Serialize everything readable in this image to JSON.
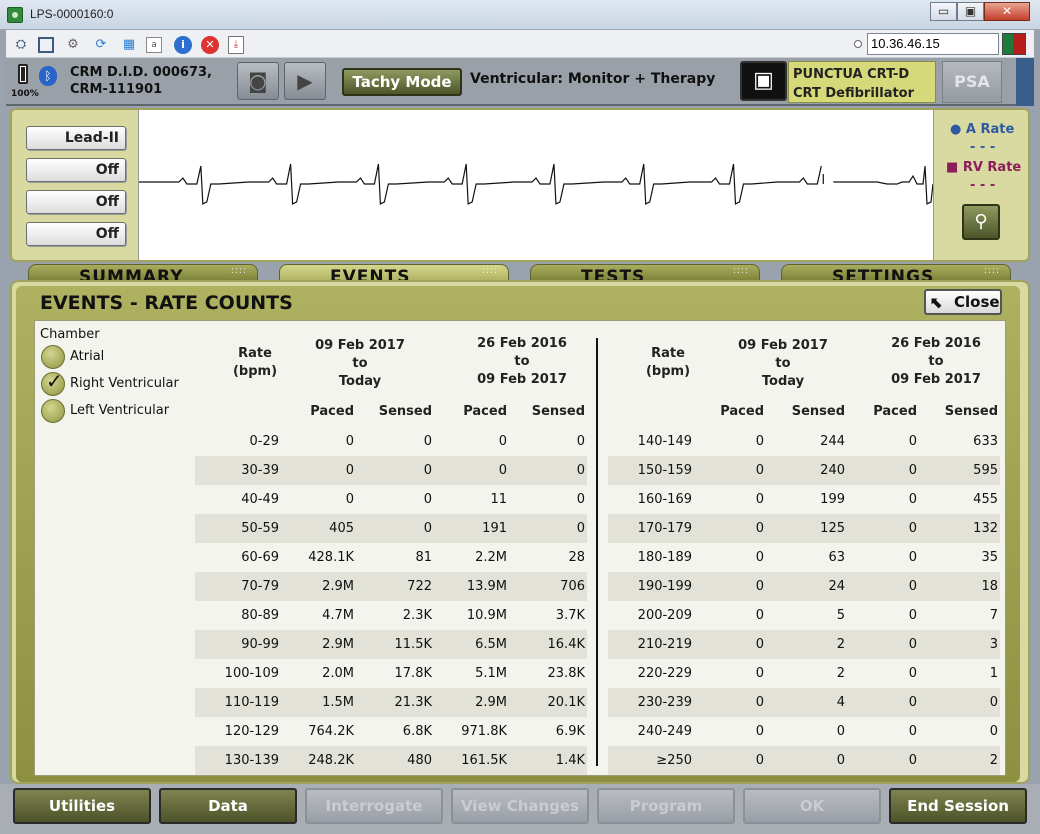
{
  "window": {
    "title": "LPS-0000160:0",
    "minimize": "▭",
    "maximize": "▣",
    "close": "✕"
  },
  "toolbar": {
    "ip_address": "10.36.46.15"
  },
  "header": {
    "battery_pct": "100%",
    "did_line1": "CRM D.I.D. 000673,",
    "did_line2": "CRM-111901",
    "tachy_mode": "Tachy Mode",
    "therapy_mode": "Ventricular: Monitor + Therapy",
    "device_line1": "PUNCTUA CRT-D",
    "device_line2": "CRT Defibrillator",
    "psa": "PSA"
  },
  "ecg": {
    "leads": [
      "Lead-II",
      "Off",
      "Off",
      "Off"
    ],
    "a_rate_label": "A Rate",
    "a_rate_value": "- - -",
    "rv_rate_label": "RV Rate",
    "rv_rate_value": "- - -"
  },
  "tabs": [
    "SUMMARY",
    "EVENTS",
    "TESTS",
    "SETTINGS"
  ],
  "events": {
    "title": "EVENTS - RATE COUNTS",
    "close_label": "Close",
    "chamber_label": "Chamber",
    "chambers": [
      {
        "label": "Atrial",
        "checked": false
      },
      {
        "label": "Right Ventricular",
        "checked": true
      },
      {
        "label": "Left Ventricular",
        "checked": false
      }
    ],
    "col_rate": "Rate (bpm)",
    "period1": [
      "09 Feb 2017",
      "to",
      "Today"
    ],
    "period2": [
      "26 Feb 2016",
      "to",
      "09 Feb 2017"
    ],
    "paced": "Paced",
    "sensed": "Sensed",
    "left_rows": [
      [
        "0-29",
        "0",
        "0",
        "0",
        "0"
      ],
      [
        "30-39",
        "0",
        "0",
        "0",
        "0"
      ],
      [
        "40-49",
        "0",
        "0",
        "11",
        "0"
      ],
      [
        "50-59",
        "405",
        "0",
        "191",
        "0"
      ],
      [
        "60-69",
        "428.1K",
        "81",
        "2.2M",
        "28"
      ],
      [
        "70-79",
        "2.9M",
        "722",
        "13.9M",
        "706"
      ],
      [
        "80-89",
        "4.7M",
        "2.3K",
        "10.9M",
        "3.7K"
      ],
      [
        "90-99",
        "2.9M",
        "11.5K",
        "6.5M",
        "16.4K"
      ],
      [
        "100-109",
        "2.0M",
        "17.8K",
        "5.1M",
        "23.8K"
      ],
      [
        "110-119",
        "1.5M",
        "21.3K",
        "2.9M",
        "20.1K"
      ],
      [
        "120-129",
        "764.2K",
        "6.8K",
        "971.8K",
        "6.9K"
      ],
      [
        "130-139",
        "248.2K",
        "480",
        "161.5K",
        "1.4K"
      ]
    ],
    "right_rows": [
      [
        "140-149",
        "0",
        "244",
        "0",
        "633"
      ],
      [
        "150-159",
        "0",
        "240",
        "0",
        "595"
      ],
      [
        "160-169",
        "0",
        "199",
        "0",
        "455"
      ],
      [
        "170-179",
        "0",
        "125",
        "0",
        "132"
      ],
      [
        "180-189",
        "0",
        "63",
        "0",
        "35"
      ],
      [
        "190-199",
        "0",
        "24",
        "0",
        "18"
      ],
      [
        "200-209",
        "0",
        "5",
        "0",
        "7"
      ],
      [
        "210-219",
        "0",
        "2",
        "0",
        "3"
      ],
      [
        "220-229",
        "0",
        "2",
        "0",
        "1"
      ],
      [
        "230-239",
        "0",
        "4",
        "0",
        "0"
      ],
      [
        "240-249",
        "0",
        "0",
        "0",
        "0"
      ],
      [
        "≥250",
        "0",
        "0",
        "0",
        "2"
      ]
    ]
  },
  "bottom_buttons": [
    {
      "label": "Utilities",
      "enabled": true
    },
    {
      "label": "Data",
      "enabled": true
    },
    {
      "label": "Interrogate",
      "enabled": false
    },
    {
      "label": "View Changes",
      "enabled": false
    },
    {
      "label": "Program",
      "enabled": false
    },
    {
      "label": "OK",
      "enabled": false
    },
    {
      "label": "End Session",
      "enabled": true
    }
  ]
}
